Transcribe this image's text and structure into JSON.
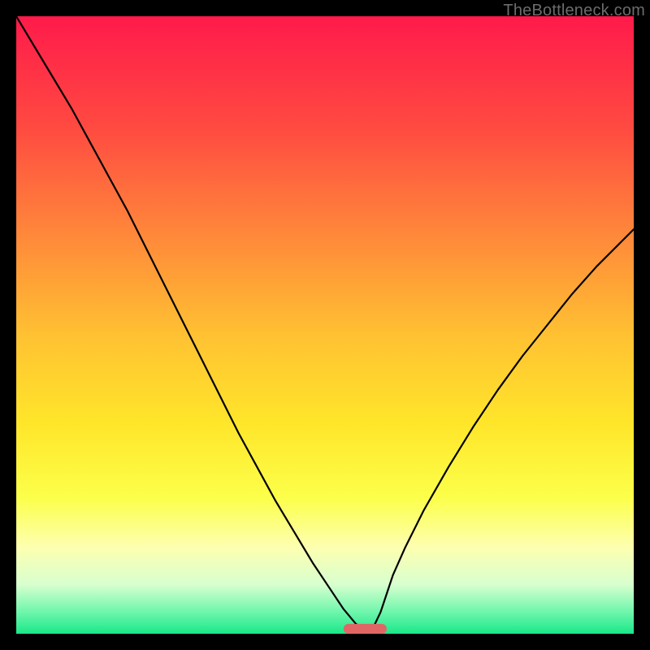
{
  "watermark": "TheBottleneck.com",
  "chart_data": {
    "type": "line",
    "title": "",
    "xlabel": "",
    "ylabel": "",
    "xlim": [
      0,
      100
    ],
    "ylim": [
      0,
      100
    ],
    "background_gradient_stops": [
      {
        "offset": 0.0,
        "color": "#ff1a4b"
      },
      {
        "offset": 0.18,
        "color": "#ff4a41"
      },
      {
        "offset": 0.36,
        "color": "#ff8a3a"
      },
      {
        "offset": 0.52,
        "color": "#ffc232"
      },
      {
        "offset": 0.66,
        "color": "#ffe62a"
      },
      {
        "offset": 0.78,
        "color": "#fcff4a"
      },
      {
        "offset": 0.86,
        "color": "#fdffb0"
      },
      {
        "offset": 0.92,
        "color": "#d8ffcf"
      },
      {
        "offset": 0.96,
        "color": "#7af7b0"
      },
      {
        "offset": 1.0,
        "color": "#19e889"
      }
    ],
    "series": [
      {
        "name": "bottleneck-curve",
        "x": [
          0.0,
          3.0,
          6.0,
          9.0,
          12.0,
          15.0,
          18.0,
          21.0,
          24.0,
          27.0,
          30.0,
          33.0,
          36.0,
          39.0,
          42.0,
          45.0,
          48.0,
          51.0,
          53.0,
          55.0,
          56.0,
          57.0,
          58.0,
          59.0,
          60.0,
          61.0,
          63.0,
          66.0,
          70.0,
          74.0,
          78.0,
          82.0,
          86.0,
          90.0,
          94.0,
          98.0,
          100.0
        ],
        "y": [
          100.0,
          95.0,
          90.0,
          85.0,
          79.5,
          74.0,
          68.5,
          62.5,
          56.5,
          50.5,
          44.5,
          38.5,
          32.5,
          27.0,
          21.5,
          16.5,
          11.5,
          7.0,
          4.0,
          1.6,
          1.0,
          1.0,
          1.4,
          3.5,
          6.5,
          9.5,
          14.0,
          20.0,
          27.0,
          33.5,
          39.5,
          45.0,
          50.0,
          55.0,
          59.5,
          63.5,
          65.5
        ]
      }
    ],
    "marker": {
      "name": "optimum-marker",
      "x_center": 56.5,
      "y": 0.8,
      "width": 7.0,
      "height": 1.6,
      "color": "#e06666"
    }
  }
}
